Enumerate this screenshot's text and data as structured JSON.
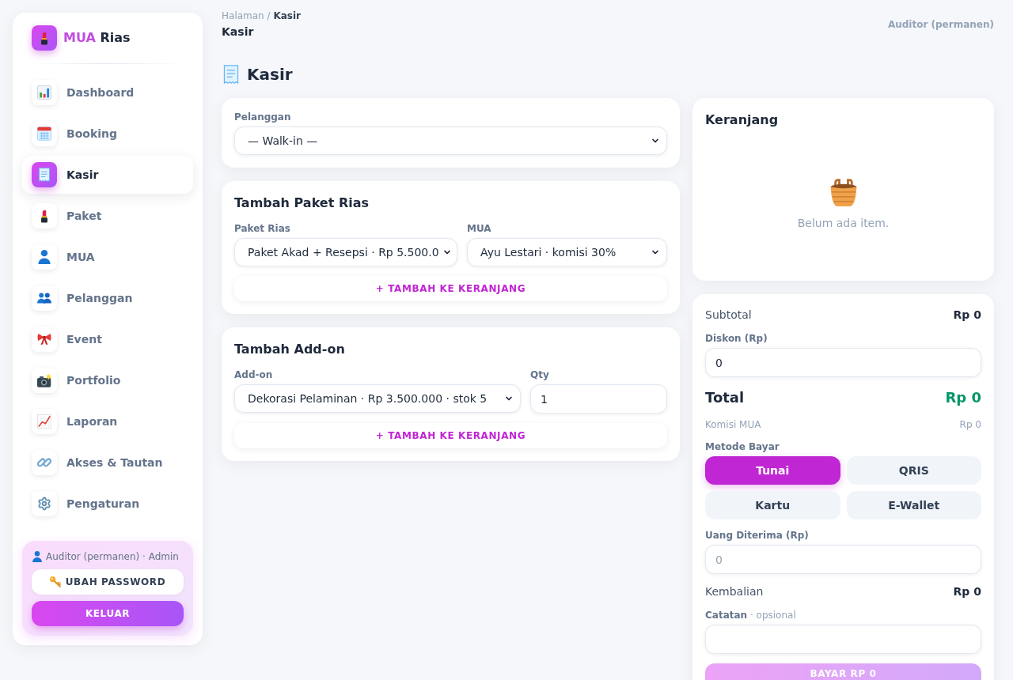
{
  "sidebar": {
    "brand": {
      "accent": "MUA",
      "rest": "Rias"
    },
    "nav": [
      {
        "label": "Dashboard",
        "selected": false
      },
      {
        "label": "Booking",
        "selected": false
      },
      {
        "label": "Kasir",
        "selected": true
      },
      {
        "label": "Paket",
        "selected": false
      },
      {
        "label": "MUA",
        "selected": false
      },
      {
        "label": "Pelanggan",
        "selected": false
      },
      {
        "label": "Event",
        "selected": false
      },
      {
        "label": "Portfolio",
        "selected": false
      },
      {
        "label": "Laporan",
        "selected": false
      },
      {
        "label": "Akses & Tautan",
        "selected": false
      },
      {
        "label": "Pengaturan",
        "selected": false
      }
    ],
    "account": {
      "user": "Auditor (permanen) · Admin",
      "change_password": "UBAH PASSWORD",
      "logout": "KELUAR"
    }
  },
  "topbar": {
    "breadcrumb": "Halaman / **Kasir**",
    "page": "Kasir",
    "user": "Auditor (permanen)"
  },
  "page_title": "Kasir",
  "customer_card": {
    "label": "Pelanggan",
    "value": "— Walk-in —"
  },
  "package_card": {
    "title": "Tambah Paket Rias",
    "package": {
      "label": "Paket Rias",
      "value": "Paket Akad + Resepsi · Rp 5.500.0"
    },
    "mua": {
      "label": "MUA",
      "value": "Ayu Lestari · komisi 30%"
    },
    "button": "+ TAMBAH KE KERANJANG"
  },
  "addon_card": {
    "title": "Tambah Add-on",
    "addon": {
      "label": "Add-on",
      "value": "Dekorasi Pelaminan · Rp 3.500.000 · stok 5"
    },
    "qty": {
      "label": "Qty",
      "value": "1"
    },
    "button": "+ TAMBAH KE KERANJANG"
  },
  "cart": {
    "title": "Keranjang",
    "empty_text": "Belum ada item."
  },
  "summary": {
    "subtotal": {
      "label": "Subtotal",
      "value": "Rp 0"
    },
    "discount": {
      "label": "Diskon (Rp)",
      "value": "0"
    },
    "total": {
      "label": "Total",
      "value": "Rp 0"
    },
    "commission": {
      "label": "Komisi MUA",
      "value": "Rp 0"
    },
    "payment": {
      "label": "Metode Bayar",
      "methods": [
        {
          "label": "Tunai",
          "selected": true
        },
        {
          "label": "QRIS",
          "selected": false
        },
        {
          "label": "Kartu",
          "selected": false
        },
        {
          "label": "E-Wallet",
          "selected": false
        }
      ]
    },
    "received": {
      "label": "Uang Diterima (Rp)",
      "placeholder": "0"
    },
    "change": {
      "label": "Kembalian",
      "value": "Rp 0"
    },
    "note": {
      "label": "**Catatan** · opsional"
    },
    "pay_button": {
      "label": "BAYAR RP 0",
      "disabled": true
    }
  }
}
